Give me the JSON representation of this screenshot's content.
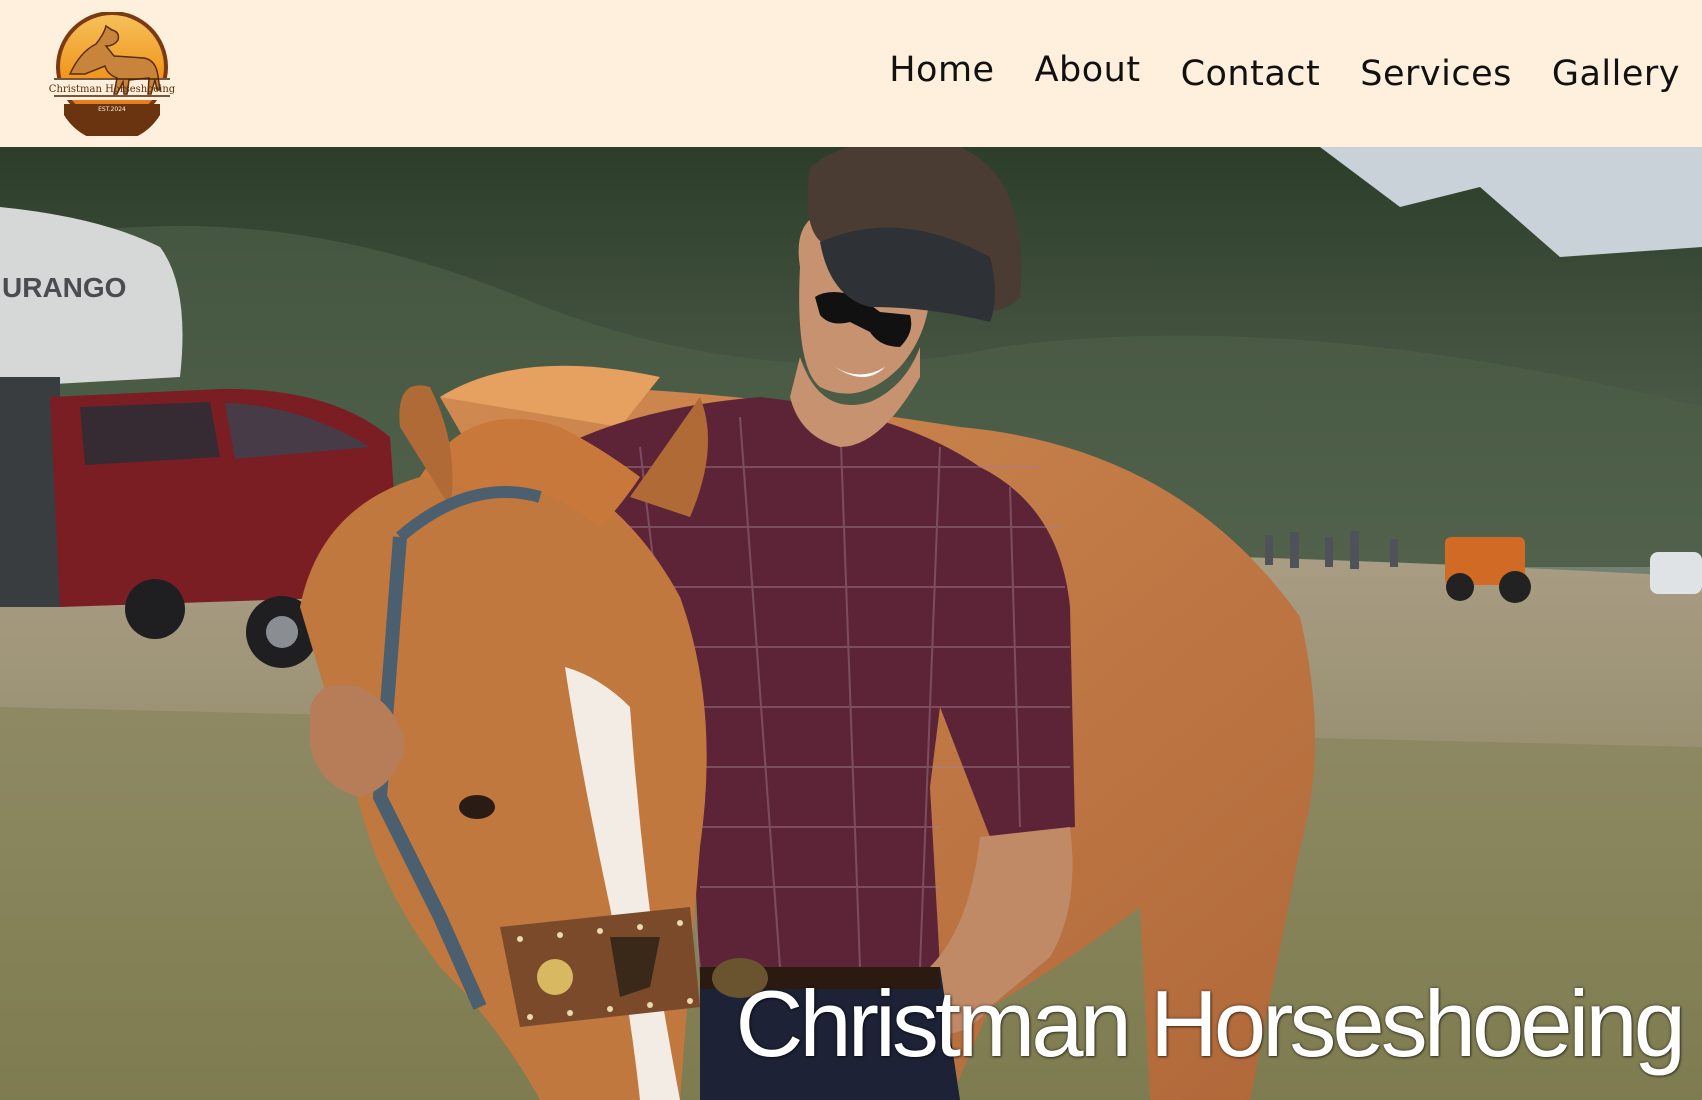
{
  "brand": {
    "logo_text": "Christman Horseshoeing",
    "logo_year": "EST.2024"
  },
  "nav": {
    "items": [
      {
        "label": "Home"
      },
      {
        "label": "About"
      },
      {
        "label": "Contact"
      },
      {
        "label": "Services"
      },
      {
        "label": "Gallery"
      }
    ]
  },
  "hero": {
    "title": "Christman Horseshoeing",
    "trailer_text": "URANGO"
  },
  "colors": {
    "header_bg": "#fef0dc",
    "logo_orange": "#f29a1f",
    "logo_brown": "#6a3410",
    "text": "#111111"
  }
}
